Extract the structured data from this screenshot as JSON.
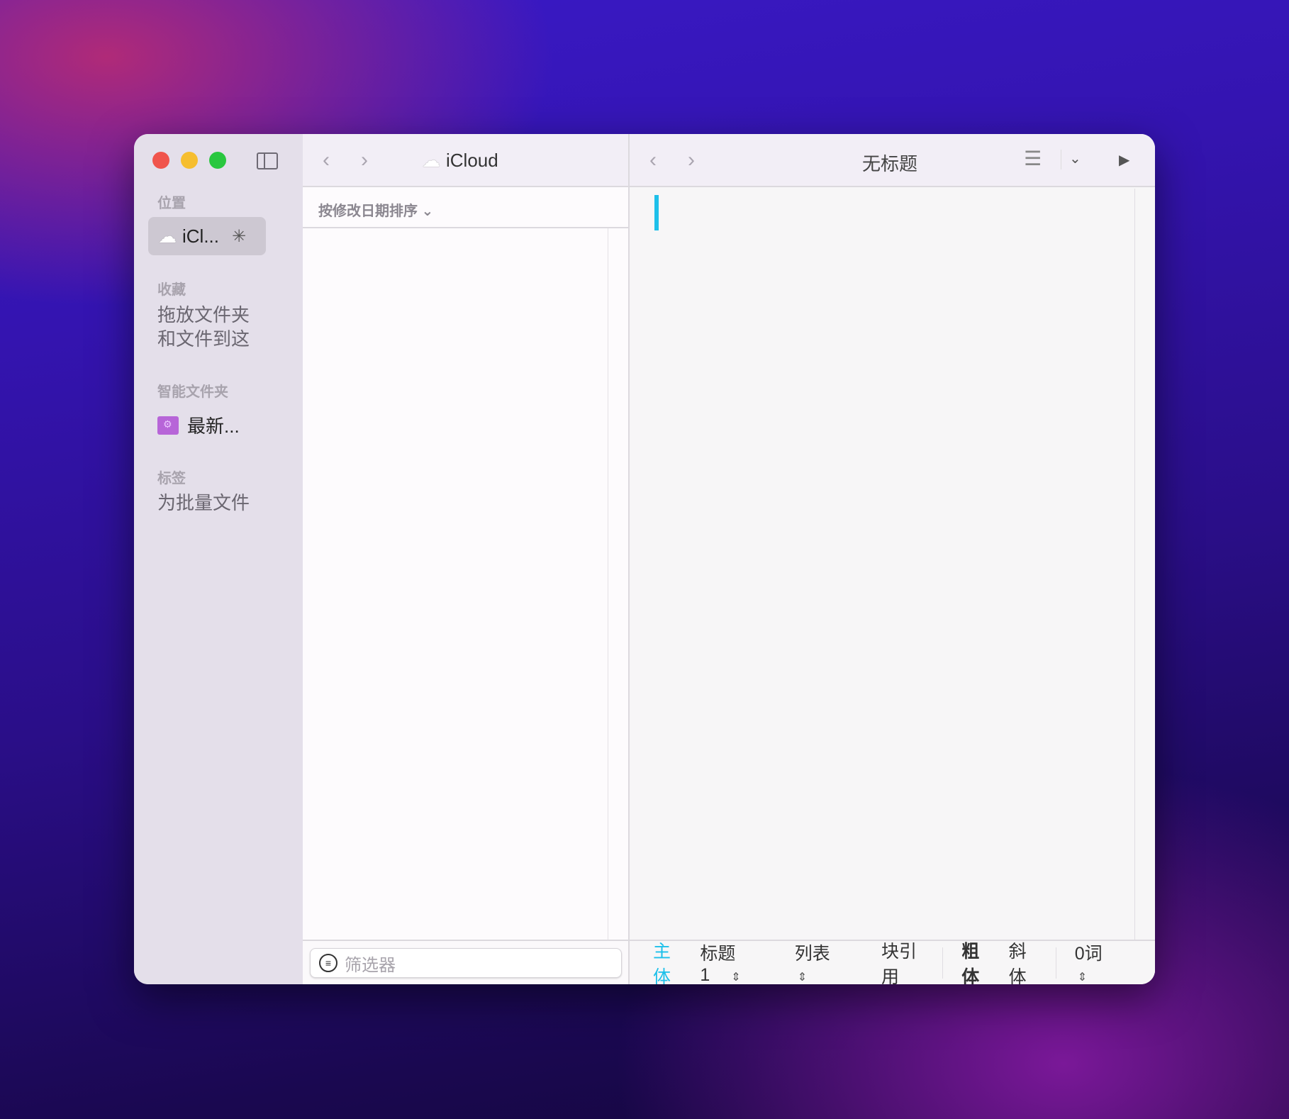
{
  "window": {
    "traffic_lights": [
      "#f0544c",
      "#f6be2f",
      "#29c73f"
    ]
  },
  "sidebar": {
    "sections": [
      {
        "label": "位置"
      },
      {
        "label": "收藏"
      },
      {
        "label": "智能文件夹"
      },
      {
        "label": "标签"
      }
    ],
    "location_item": {
      "label": "iCl...",
      "icon": "cloud-icon",
      "status_icon": "spinner-icon"
    },
    "favorites_hint": [
      "拖放文件夹",
      "和文件到这"
    ],
    "smart_folder": {
      "label": "最新...",
      "icon": "smart-folder-icon"
    },
    "tags_hint": "为批量文件"
  },
  "browser": {
    "title": "iCloud",
    "sort_label": "按修改日期排序",
    "filter_placeholder": "筛选器"
  },
  "editor": {
    "title": "无标题",
    "accent": "#1ec0ea",
    "format_bar": {
      "body": "主体",
      "heading": "标题1",
      "list": "列表",
      "blockquote": "块引用",
      "bold": "粗体",
      "italic": "斜体",
      "word_count": "0词"
    }
  }
}
